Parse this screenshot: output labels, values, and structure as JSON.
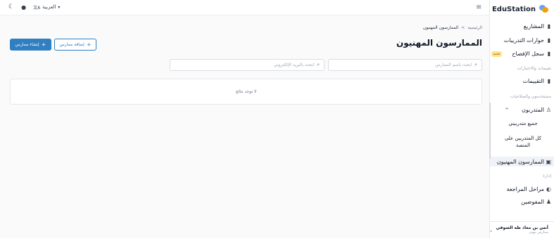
{
  "app": {
    "name": "EduStation"
  },
  "topbar": {
    "language_label": "العربية",
    "lang_icon": "translate-icon",
    "theme_icon": "moon-icon",
    "notif_icon": "bell-icon",
    "menu_icon": "hamburger-icon"
  },
  "sidebar": {
    "items": [
      {
        "label": "المشاريع",
        "icon": "folder-icon"
      },
      {
        "label": "حوارات التدريبات",
        "icon": "chat-icon"
      },
      {
        "label": "سجل الإفصاح",
        "icon": "log-icon",
        "badge": "جديد"
      },
      {
        "label": "التقييمات",
        "icon": "clipboard-icon"
      },
      {
        "label": "المتدربون",
        "icon": "user-icon"
      },
      {
        "label": "الممارسون المهنيون",
        "icon": "id-card-icon"
      },
      {
        "label": "مراحل المراجعة",
        "icon": "circle-icon"
      },
      {
        "label": "المفوضين",
        "icon": "users-icon"
      }
    ],
    "sections": {
      "evaluations": "تقييمات والاختبارات",
      "users": "مستخدمون والصلاحيات",
      "admin": "إدارة"
    },
    "sub_items": [
      "جميع متدربيني",
      "كل المتدربين على المنصة"
    ],
    "user": {
      "name": "أنس بن معاذ طه الصوفي",
      "role": "ممارس مهني"
    }
  },
  "breadcrumb": {
    "home": "الرئيسية",
    "separator": ">",
    "current": "الممارسون المهنيون"
  },
  "page": {
    "title": "الممارسون المهنيون"
  },
  "buttons": {
    "create_label": "إنشاء ممارس",
    "add_label": "إضافة ممارس",
    "plus": "+"
  },
  "search": {
    "name_placeholder": "ابحث باسم الممارس",
    "email_placeholder": "ابحث بالبريد الإلكتروني"
  },
  "results": {
    "empty_text": "لا توجد نتائج"
  },
  "colors": {
    "primary": "#2f7fc1",
    "badge": "#fde68a",
    "active_bg": "#eff2f7"
  }
}
